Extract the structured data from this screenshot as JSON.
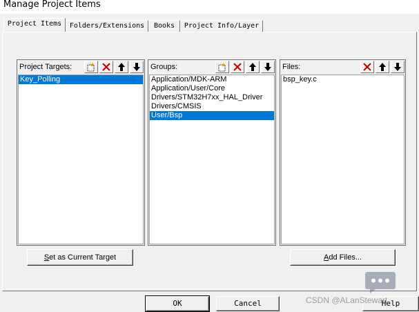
{
  "window": {
    "title": "Manage Project Items"
  },
  "tabs": [
    {
      "label": "Project Items",
      "active": true
    },
    {
      "label": "Folders/Extensions",
      "active": false
    },
    {
      "label": "Books",
      "active": false
    },
    {
      "label": "Project Info/Layer",
      "active": false
    }
  ],
  "targets": {
    "label": "Project Targets:",
    "items": [
      "Key_Polling"
    ],
    "selected_index": 0
  },
  "groups": {
    "label": "Groups:",
    "items": [
      "Application/MDK-ARM",
      "Application/User/Core",
      "Drivers/STM32H7xx_HAL_Driver",
      "Drivers/CMSIS",
      "User/Bsp"
    ],
    "selected_index": 4
  },
  "files": {
    "label": "Files:",
    "items": [
      "bsp_key.c"
    ]
  },
  "buttons": {
    "set_target_underlined": "S",
    "set_target_rest": "et as Current Target",
    "add_files_underlined": "A",
    "add_files_rest": "dd Files...",
    "ok": "OK",
    "cancel": "Cancel",
    "help": "Help"
  },
  "watermark": "CSDN @ALanStewart",
  "colors": {
    "selection": "#0078d7",
    "delete_icon": "#c00000",
    "new_icon": "#d4a000"
  },
  "icons": {
    "new": "new-item-icon",
    "delete": "delete-icon",
    "up": "arrow-up-icon",
    "down": "arrow-down-icon",
    "chat": "chat-bubble-icon"
  }
}
